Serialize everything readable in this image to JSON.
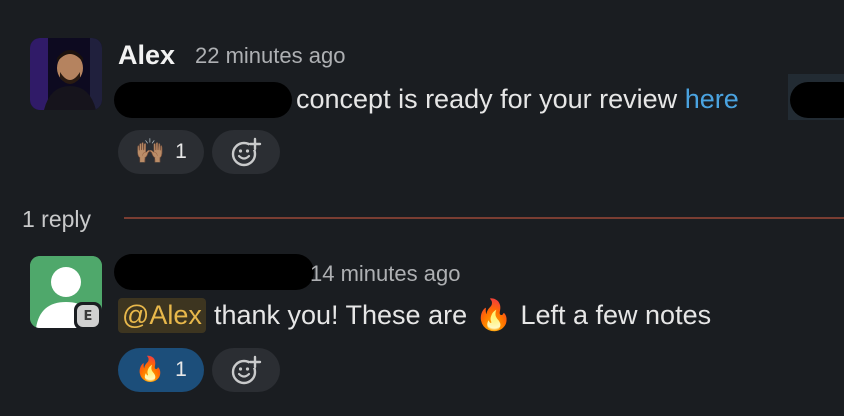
{
  "message1": {
    "author": "Alex",
    "timestamp": "22 minutes ago",
    "text": "concept is ready for your review",
    "link_text": "here",
    "reactions": [
      {
        "emoji": "🙌🏽",
        "icon": "raised-hands-icon",
        "count": "1"
      }
    ],
    "add_reaction_icon": "add-reaction-icon"
  },
  "thread_divider": {
    "label": "1 reply"
  },
  "message2": {
    "timestamp": "14 minutes ago",
    "external_badge": "E",
    "mention": "@Alex",
    "text_before_emoji": "thank you! These are",
    "inline_emoji": "🔥",
    "text_after_emoji": "Left a few notes",
    "reactions": [
      {
        "emoji": "🔥",
        "icon": "fire-icon",
        "count": "1"
      }
    ],
    "add_reaction_icon": "add-reaction-icon"
  },
  "colors": {
    "background": "#1a1d21",
    "link": "#4aa3e0",
    "mention_text": "#e8b84b",
    "mention_bg": "#3d3520",
    "divider_line": "#7a3d32",
    "active_reaction_bg": "#1c4e7a"
  }
}
